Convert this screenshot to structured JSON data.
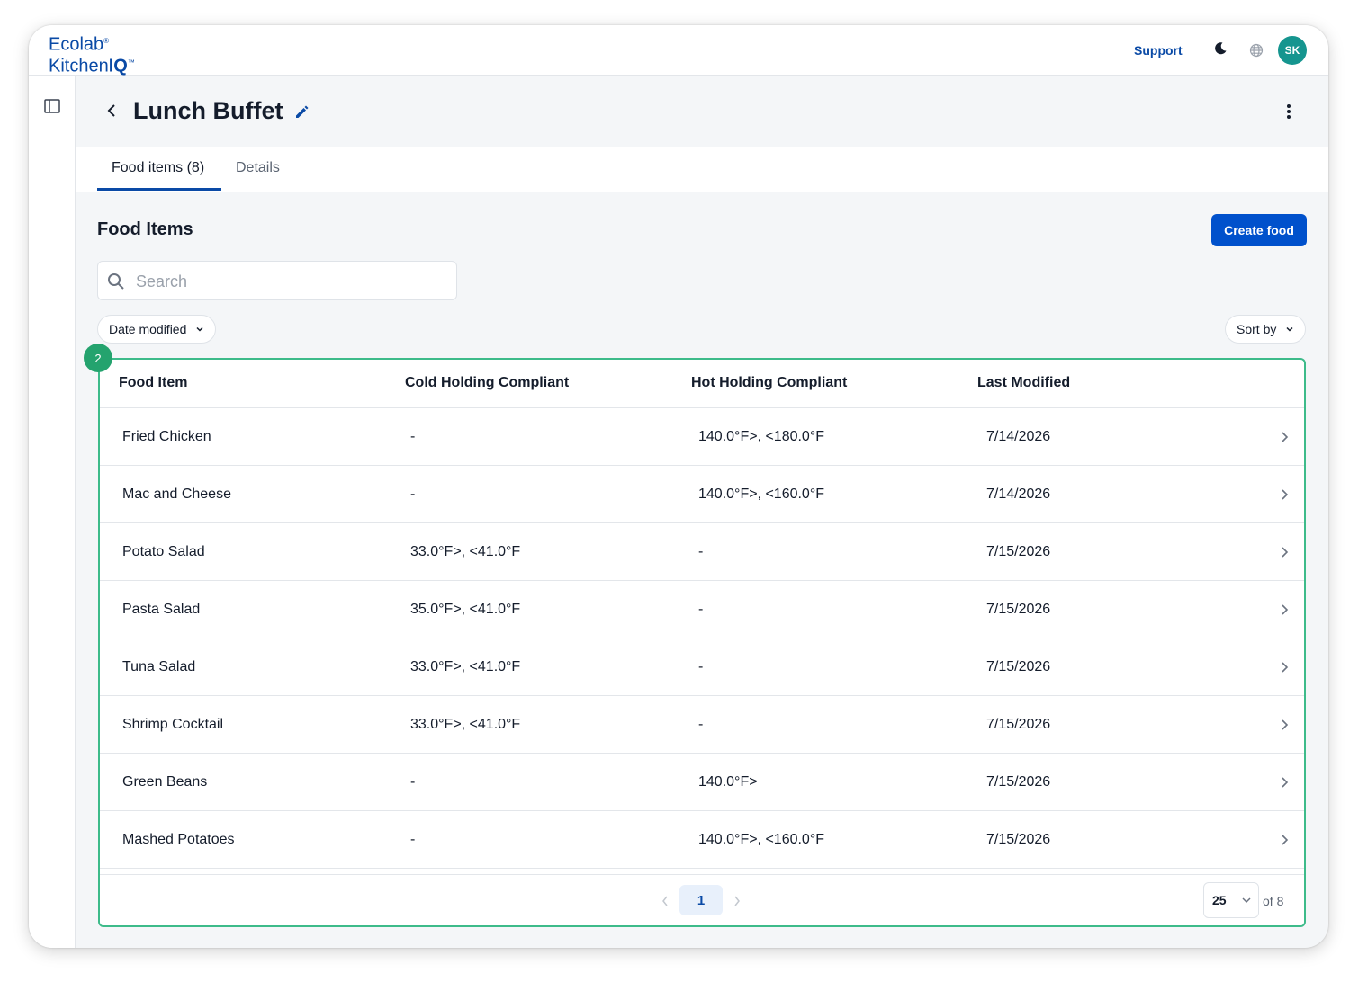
{
  "brand": {
    "line1": "Ecolab",
    "line1_mark": "®",
    "line2_a": "Kitchen",
    "line2_b": "IQ",
    "line2_mark": "™"
  },
  "topbar": {
    "support_label": "Support",
    "avatar_initials": "SK",
    "theme_icon": "moon-icon",
    "language_icon": "globe-icon"
  },
  "page": {
    "title": "Lunch Buffet"
  },
  "tabs": [
    {
      "label": "Food items (8)",
      "active": true
    },
    {
      "label": "Details",
      "active": false
    }
  ],
  "section": {
    "title": "Food Items",
    "create_label": "Create food"
  },
  "search": {
    "placeholder": "Search",
    "value": ""
  },
  "filters": {
    "date_filter": "Date modified",
    "sort_label": "Sort by"
  },
  "badge": "2",
  "table": {
    "headers": [
      "Food Item",
      "Cold Holding Compliant",
      "Hot Holding Compliant",
      "Last Modified"
    ],
    "rows": [
      {
        "name": "Fried Chicken",
        "cold": "-",
        "hot": "140.0°F>,  <180.0°F",
        "modified": "7/14/2026"
      },
      {
        "name": "Mac and Cheese",
        "cold": "-",
        "hot": "140.0°F>,  <160.0°F",
        "modified": "7/14/2026"
      },
      {
        "name": "Potato Salad",
        "cold": "33.0°F>,  <41.0°F",
        "hot": "-",
        "modified": "7/15/2026"
      },
      {
        "name": "Pasta Salad",
        "cold": "35.0°F>,  <41.0°F",
        "hot": "-",
        "modified": "7/15/2026"
      },
      {
        "name": "Tuna Salad",
        "cold": "33.0°F>,  <41.0°F",
        "hot": "-",
        "modified": "7/15/2026"
      },
      {
        "name": "Shrimp Cocktail",
        "cold": "33.0°F>,  <41.0°F",
        "hot": "-",
        "modified": "7/15/2026"
      },
      {
        "name": "Green Beans",
        "cold": "-",
        "hot": "140.0°F>",
        "modified": "7/15/2026"
      },
      {
        "name": "Mashed Potatoes",
        "cold": "-",
        "hot": "140.0°F>,  <160.0°F",
        "modified": "7/15/2026"
      }
    ]
  },
  "pagination": {
    "current_page": "1",
    "per_page": "25",
    "total_label": "of 8"
  },
  "colors": {
    "brand_blue": "#0a4aa6",
    "primary_button": "#0051cc",
    "avatar": "#15958f",
    "highlight_border": "#3dbb8a"
  }
}
